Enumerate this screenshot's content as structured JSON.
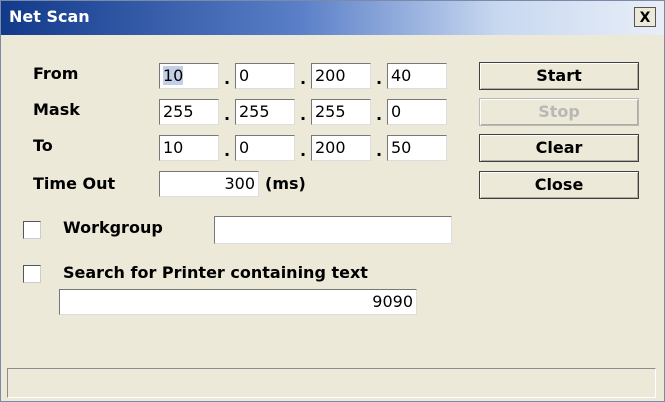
{
  "window": {
    "title": "Net Scan",
    "close_label": "X"
  },
  "labels": {
    "from": "From",
    "mask": "Mask",
    "to": "To",
    "timeout": "Time Out",
    "timeout_unit": "(ms)",
    "workgroup": "Workgroup",
    "search_printer": "Search for Printer containing text"
  },
  "ip": {
    "from": [
      "10",
      "0",
      "200",
      "40"
    ],
    "mask": [
      "255",
      "255",
      "255",
      "0"
    ],
    "to": [
      "10",
      "0",
      "200",
      "50"
    ],
    "separator": "."
  },
  "timeout_value": "300",
  "workgroup_value": "",
  "printer_text_value": "9090",
  "workgroup_checked": false,
  "search_printer_checked": false,
  "buttons": {
    "start": "Start",
    "stop": "Stop",
    "clear": "Clear",
    "close": "Close"
  },
  "status_text": ""
}
